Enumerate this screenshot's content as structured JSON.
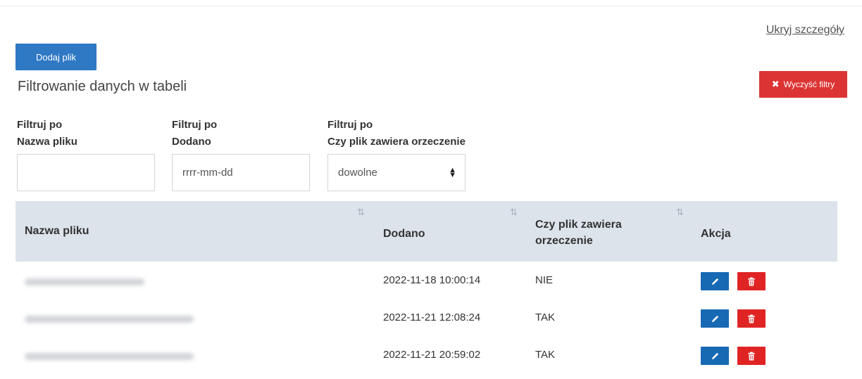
{
  "links": {
    "hide_details": "Ukryj szczegóły"
  },
  "buttons": {
    "add_file": "Dodaj plik",
    "clear_filters": "Wyczyść filtry",
    "clear_icon": "✖"
  },
  "section": {
    "title": "Filtrowanie danych w tabeli"
  },
  "filters": [
    {
      "line1": "Filtruj po",
      "line2": "Nazwa pliku",
      "value": ""
    },
    {
      "line1": "Filtruj po",
      "line2": "Dodano",
      "placeholder": "rrrr-mm-dd"
    },
    {
      "line1": "Filtruj po",
      "line2": "Czy plik zawiera orzeczenie",
      "selected": "dowolne"
    }
  ],
  "table": {
    "columns": {
      "name": "Nazwa pliku",
      "added": "Dodano",
      "ruling_line1": "Czy plik zawiera",
      "ruling_line2": "orzeczenie",
      "action": "Akcja"
    },
    "sort_glyph": "⇅",
    "rows": [
      {
        "added": "2022-11-18 10:00:14",
        "ruling": "NIE"
      },
      {
        "added": "2022-11-21 12:08:24",
        "ruling": "TAK"
      },
      {
        "added": "2022-11-21 20:59:02",
        "ruling": "TAK"
      }
    ]
  },
  "colors": {
    "primary": "#2e78c4",
    "danger": "#dc3434",
    "header_bg": "#dde3eb",
    "edit": "#1769b3"
  },
  "icons": {
    "edit": "pencil-icon",
    "delete": "trash-icon",
    "sort": "sort-icon",
    "select": "updown-icon"
  }
}
